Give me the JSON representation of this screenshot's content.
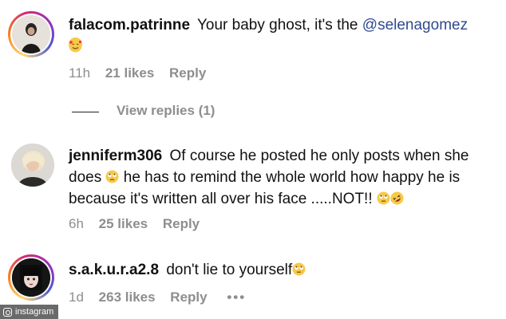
{
  "comments": [
    {
      "username": "falacom.patrinne",
      "text_before": "Your baby ghost, it's the ",
      "mention": "@selenagomez",
      "emoji": "smiling-face-with-hearts",
      "time": "11h",
      "likes": "21 likes",
      "reply": "Reply"
    },
    {
      "username": "jenniferm306",
      "text_1": "Of course he posted he only posts when she does ",
      "emoji_1": "face-with-rolling-eyes",
      "text_2": " he has to remind the whole world how happy he is because it's written all over his face .....NOT!! ",
      "emoji_2": "face-with-rolling-eyes",
      "emoji_3": "rolling-on-the-floor-laughing",
      "time": "6h",
      "likes": "25 likes",
      "reply": "Reply"
    },
    {
      "username": "s.a.k.u.r.a2.8",
      "text": "don't lie to yourself",
      "emoji": "face-with-rolling-eyes",
      "time": "1d",
      "likes": "263 likes",
      "reply": "Reply",
      "more": "•••"
    }
  ],
  "view_replies": "View replies (1)",
  "watermark": "instagram",
  "colors": {
    "mention": "#2f4a8f",
    "meta_gray": "#8e8e8e",
    "emoji_yellow": "#f7c948"
  }
}
